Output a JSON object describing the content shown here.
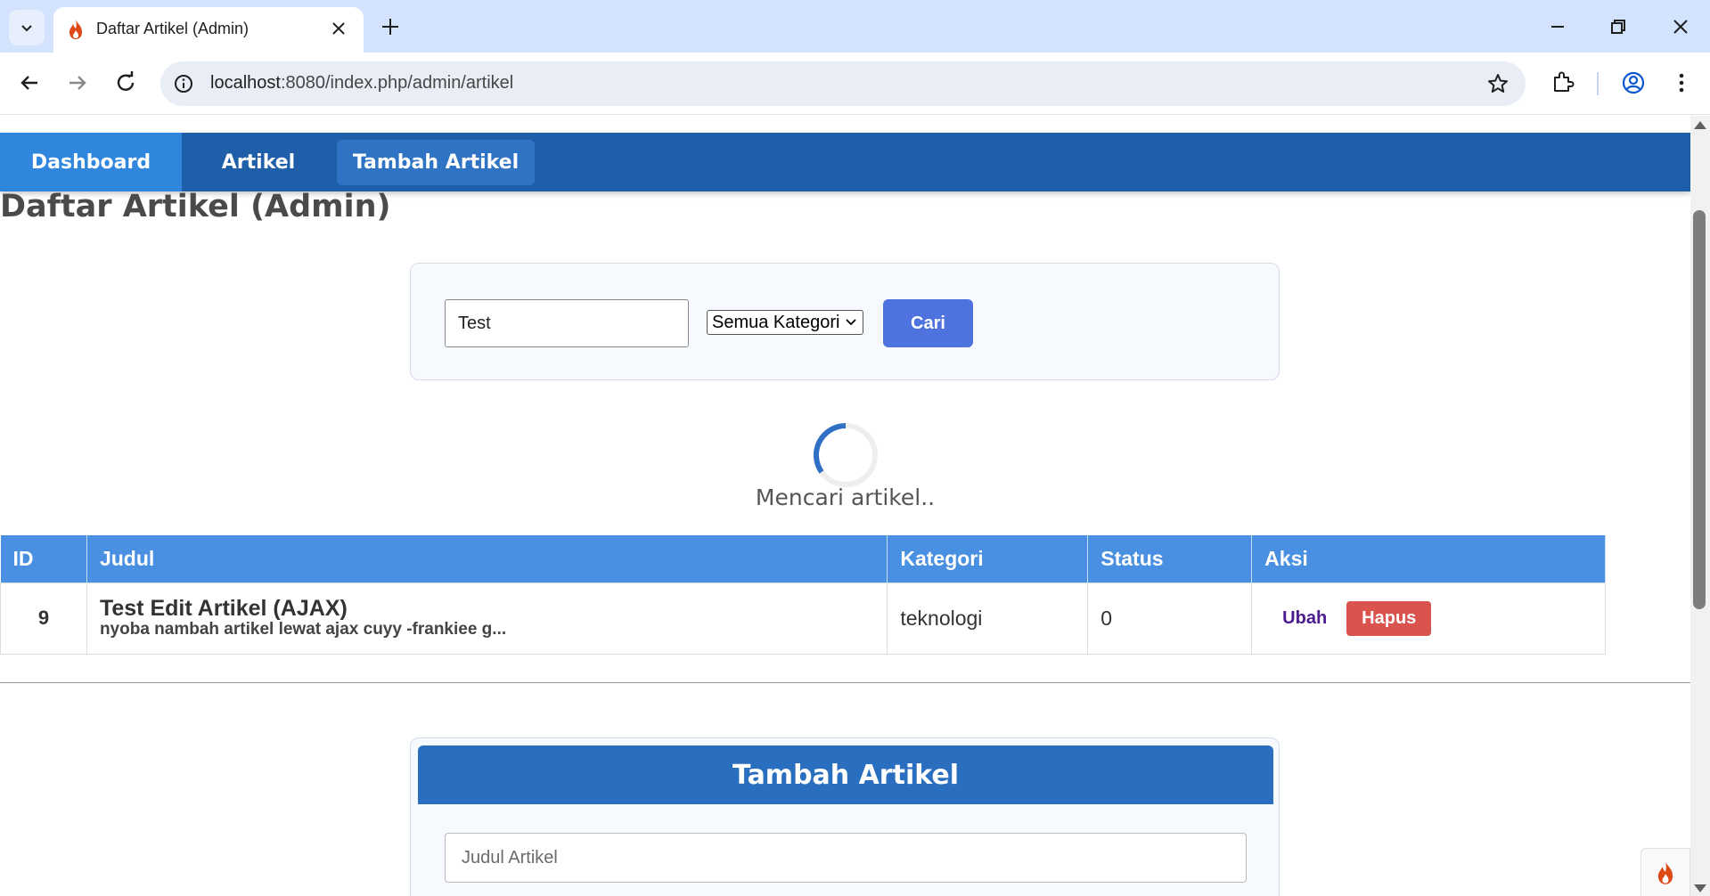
{
  "browser": {
    "tab_title": "Daftar Artikel (Admin)",
    "url_host": "localhost",
    "url_path": ":8080/index.php/admin/artikel"
  },
  "nav": {
    "items": [
      {
        "label": "Dashboard",
        "active": true
      },
      {
        "label": "Artikel",
        "active": false
      },
      {
        "label": "Tambah Artikel",
        "active": false
      }
    ]
  },
  "page": {
    "title": "Daftar Artikel (Admin)"
  },
  "search": {
    "query": "Test",
    "category_selected": "Semua Kategori",
    "button_label": "Cari"
  },
  "loading": {
    "text": "Mencari artikel.."
  },
  "table": {
    "headers": [
      "ID",
      "Judul",
      "Kategori",
      "Status",
      "Aksi"
    ],
    "rows": [
      {
        "id": "9",
        "title": "Test Edit Artikel (AJAX)",
        "excerpt": "nyoba nambah artikel lewat ajax cuyy -frankiee g...",
        "category": "teknologi",
        "status": "0",
        "edit_label": "Ubah",
        "delete_label": "Hapus"
      }
    ]
  },
  "form": {
    "title": "Tambah Artikel",
    "judul_placeholder": "Judul Artikel"
  },
  "colors": {
    "navbar": "#1f5faa",
    "nav_active": "#2f86dc",
    "table_header": "#4a90e2",
    "primary_button": "#4e73df",
    "danger_button": "#d9534f",
    "form_header": "#2a6ebf"
  }
}
